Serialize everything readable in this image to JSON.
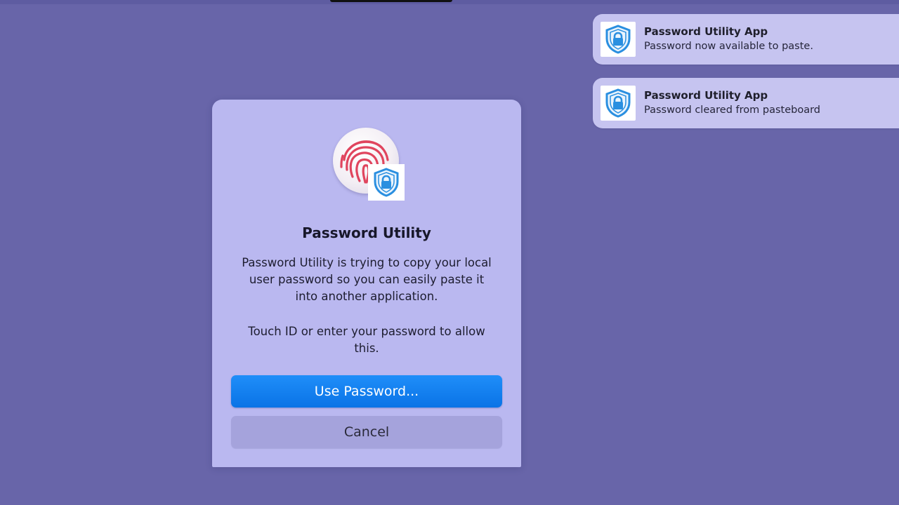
{
  "notifications": [
    {
      "title": "Password Utility App",
      "body": "Password now available to paste.",
      "icon": "shield-lock-icon"
    },
    {
      "title": "Password Utility App",
      "body": "Password cleared from pasteboard",
      "icon": "shield-lock-icon"
    }
  ],
  "dialog": {
    "icon": "touch-id-fingerprint-icon",
    "badge_icon": "shield-lock-icon",
    "title": "Password Utility",
    "message": "Password Utility is trying to copy your local user password so you can easily paste it into another application.",
    "message2": "Touch ID or enter your password to allow this.",
    "primary_button": "Use Password...",
    "secondary_button": "Cancel"
  },
  "colors": {
    "desktop": "#6865a9",
    "dialog_bg": "#bab8f0",
    "notification_bg": "#c6c4f0",
    "accent": "#0a73e6",
    "fingerprint": "#e0455e",
    "shield": "#2a8fe0"
  }
}
